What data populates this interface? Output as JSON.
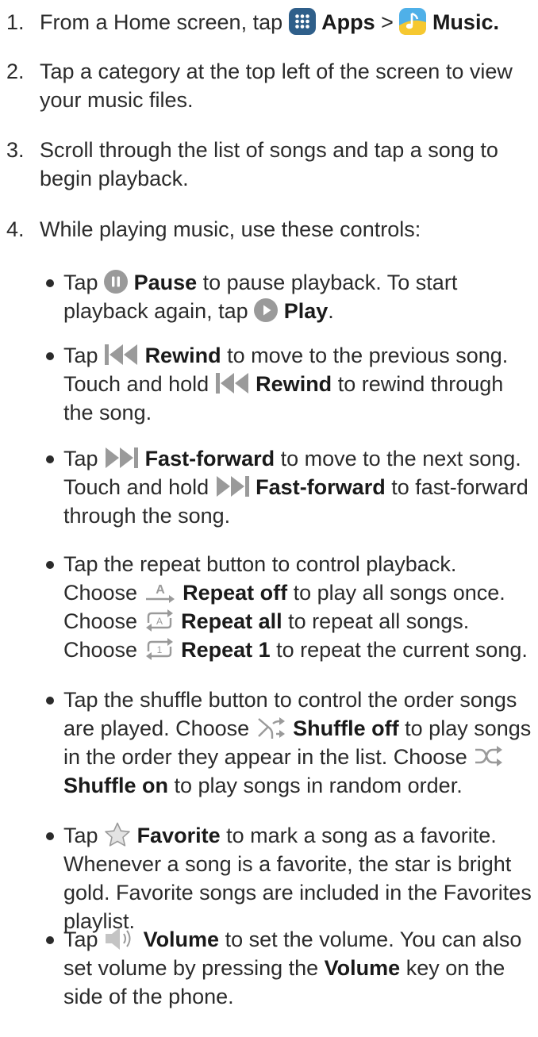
{
  "steps": [
    {
      "num": "1.",
      "pre": "From a Home screen, tap ",
      "apps": "Apps",
      "sep": " > ",
      "music": "Music."
    },
    {
      "num": "2.",
      "text": "Tap a category at the top left of the screen to view your music files."
    },
    {
      "num": "3.",
      "text": "Scroll through the list of songs and tap a song to begin playback."
    },
    {
      "num": "4.",
      "text": "While playing music, use these controls:"
    }
  ],
  "bullets": {
    "pause": {
      "t1": "Tap ",
      "b1": "Pause",
      "t2": " to pause playback. To start playback again, tap ",
      "b2": "Play",
      "t3": "."
    },
    "rewind": {
      "t1": "Tap ",
      "b1": "Rewind",
      "t2": " to move to the previous song. Touch and hold ",
      "b2": "Rewind",
      "t3": " to rewind through the song."
    },
    "ff": {
      "t1": "Tap ",
      "b1": "Fast-forward",
      "t2": " to move to the next song. Touch and hold ",
      "b2": "Fast-forward",
      "t3": " to fast-forward through the song."
    },
    "repeat": {
      "t1": "Tap the repeat button to control playback. Choose ",
      "b1": "Repeat off",
      "t2": " to play all songs once. Choose ",
      "b2": "Repeat all",
      "t3": " to repeat all songs. Choose ",
      "b3": "Repeat 1",
      "t4": " to repeat the current song."
    },
    "shuffle": {
      "t1": "Tap the shuffle button to control the order songs are played. Choose ",
      "b1": "Shuffle off",
      "t2": " to play songs in the order they appear in the list. Choose ",
      "b2": "Shuffle on",
      "t3": " to play songs in random order."
    },
    "favorite": {
      "t1": "Tap ",
      "b1": "Favorite",
      "t2": " to mark a song as a favorite. Whenever a song is a favorite, the star is bright gold. Favorite songs are included in the Favorites playlist."
    },
    "volume": {
      "t1": "Tap ",
      "b1": "Volume",
      "t2": " to set the volume. You can also set volume by pressing the ",
      "b2": "Volume",
      "t3": " key on the side of the phone."
    }
  },
  "icons": {
    "apps": "apps-grid-icon",
    "music": "music-note-icon",
    "pause": "pause-icon",
    "play": "play-icon",
    "rewind": "rewind-icon",
    "fast_forward": "fast-forward-icon",
    "repeat_off": "repeat-off-icon",
    "repeat_all": "repeat-all-icon",
    "repeat_one": "repeat-one-icon",
    "shuffle_off": "shuffle-off-icon",
    "shuffle_on": "shuffle-on-icon",
    "favorite": "star-icon",
    "volume": "volume-icon"
  },
  "icon_labels": {
    "repeat_off": "A",
    "repeat_all": "A",
    "repeat_one": "1"
  },
  "colors": {
    "text": "#2b2b2b",
    "control_icon_gray": "#9a9a9a",
    "apps_icon": "#2f5f8a",
    "music_icon_blue": "#4fb0e8",
    "music_icon_yellow": "#f6c830"
  }
}
